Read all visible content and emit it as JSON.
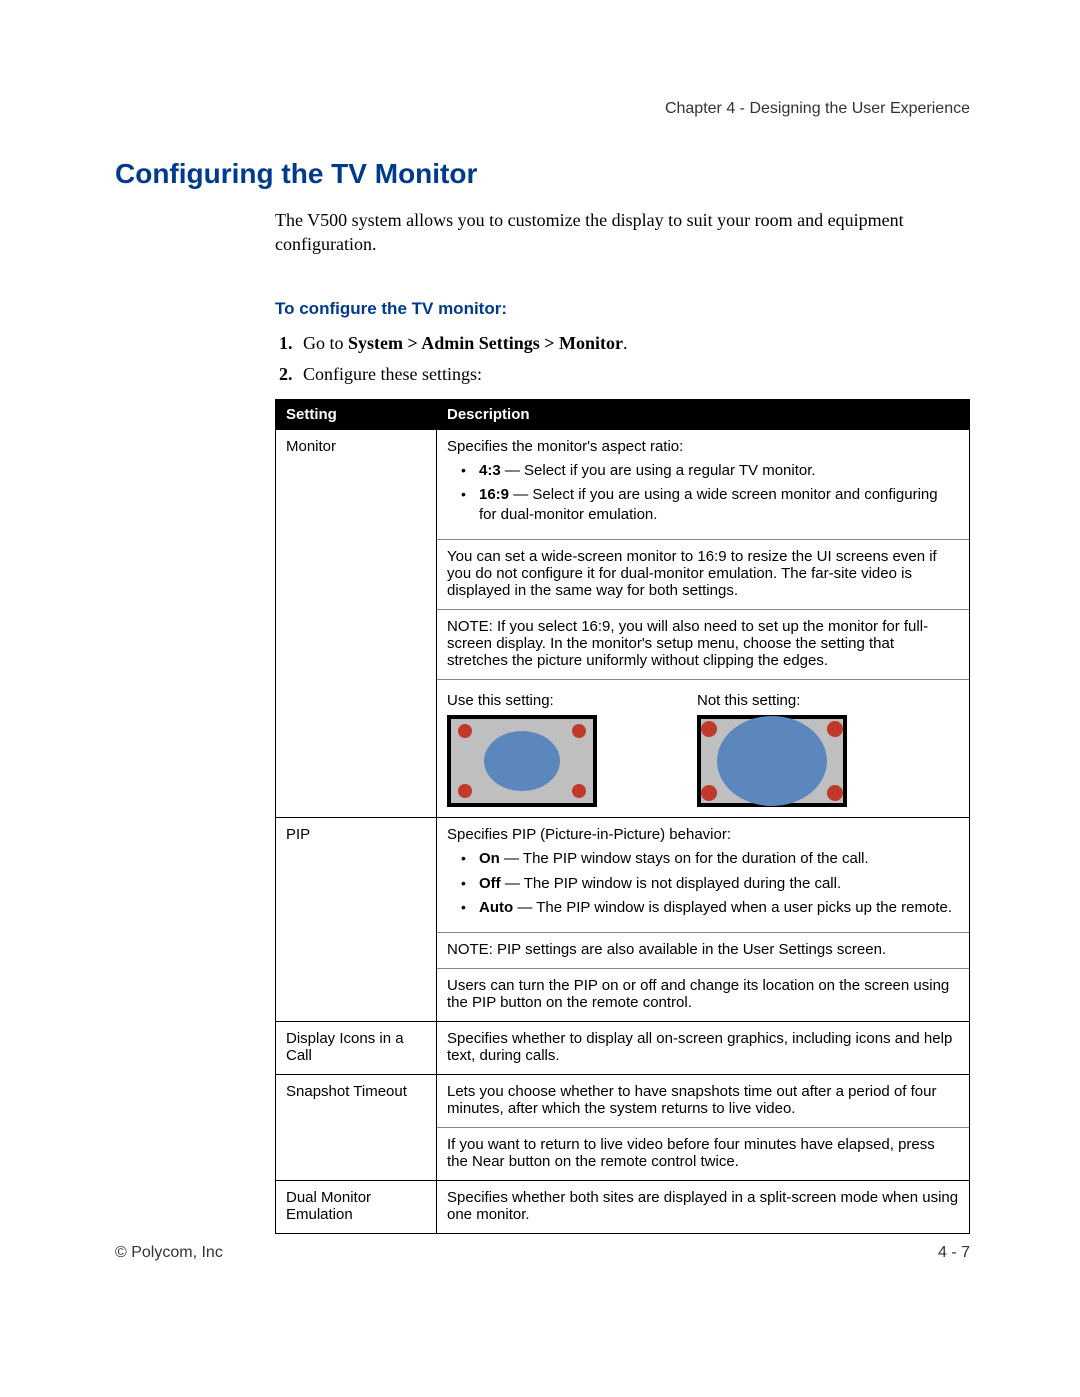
{
  "chapter": "Chapter 4 - Designing the User Experience",
  "title": "Configuring the TV Monitor",
  "intro": "The V500 system allows you to customize the display to suit your room and equipment configuration.",
  "sub_heading": "To configure the TV monitor:",
  "steps": {
    "s1_pre": "Go to ",
    "s1_bold": "System > Admin Settings > Monitor",
    "s1_post": ".",
    "s2": "Configure these settings:"
  },
  "table": {
    "head_setting": "Setting",
    "head_desc": "Description",
    "rows": {
      "monitor": {
        "name": "Monitor",
        "lead": "Specifies the monitor's aspect ratio:",
        "b1_bold": "4:3",
        "b1_rest": " — Select if you are using a regular TV monitor.",
        "b2_bold": "16:9",
        "b2_rest": " — Select if you are using a wide screen monitor and configuring for dual-monitor emulation.",
        "p2": "You can set a wide-screen monitor to 16:9 to resize the UI screens even if you do not configure it for dual-monitor emulation. The far-site video is displayed in the same way for both settings.",
        "p3": "NOTE: If you select 16:9, you will also need to set up the monitor for full-screen display. In the monitor's setup menu, choose the setting that stretches the picture uniformly without clipping the edges.",
        "use_label": "Use this setting:",
        "not_label": "Not this setting:"
      },
      "pip": {
        "name": "PIP",
        "lead": "Specifies PIP (Picture-in-Picture) behavior:",
        "b1_bold": "On",
        "b1_rest": " — The PIP window stays on for the duration of the call.",
        "b2_bold": "Off",
        "b2_rest": " — The PIP window is not displayed during the call.",
        "b3_bold": "Auto",
        "b3_rest": " — The PIP window is displayed when a user picks up the remote.",
        "p2": "NOTE: PIP settings are also available in the User Settings screen.",
        "p3": "Users can turn the PIP on or off and change its location on the screen using the PIP button on the remote control."
      },
      "display_icons": {
        "name": "Display Icons in a Call",
        "desc": "Specifies whether to display all on-screen graphics, including icons and help text, during calls."
      },
      "snapshot": {
        "name": "Snapshot Timeout",
        "p1": "Lets you choose whether to have snapshots time out after a period of four minutes, after which the system returns to live video.",
        "p2": "If you want to return to live video before four minutes have elapsed, press the Near button on the remote control twice."
      },
      "dual": {
        "name": "Dual Monitor Emulation",
        "desc": "Specifies whether both sites are displayed in a split-screen mode when using one monitor."
      }
    }
  },
  "footer": {
    "left": "© Polycom, Inc",
    "right": "4 - 7"
  }
}
